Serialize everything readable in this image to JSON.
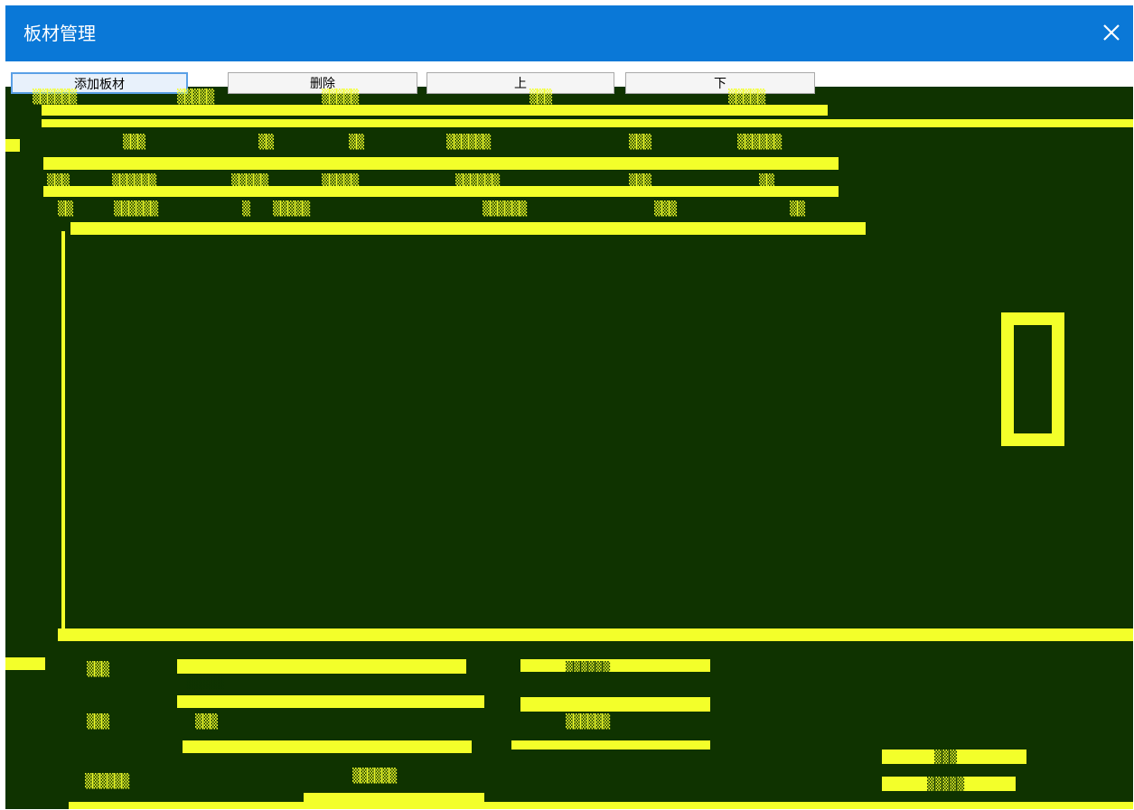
{
  "window": {
    "title": "板材管理",
    "close_glyph": "✕",
    "accent": "#0a78d7",
    "glitch_fg": "#f3ff2a",
    "glitch_bg": "#0f3300"
  },
  "toolbar": {
    "add_label": "添加板材",
    "delete_label": "删除",
    "up_label": "上",
    "down_label": "下"
  },
  "glitch_glyphs": {
    "g1": "▒▒▒▒",
    "g2": "▒▒▒",
    "g3": "▒▒▒▒▒",
    "g4": "▒▒▒▒▒▒",
    "g5": "▒▒",
    "g6": "▒"
  }
}
